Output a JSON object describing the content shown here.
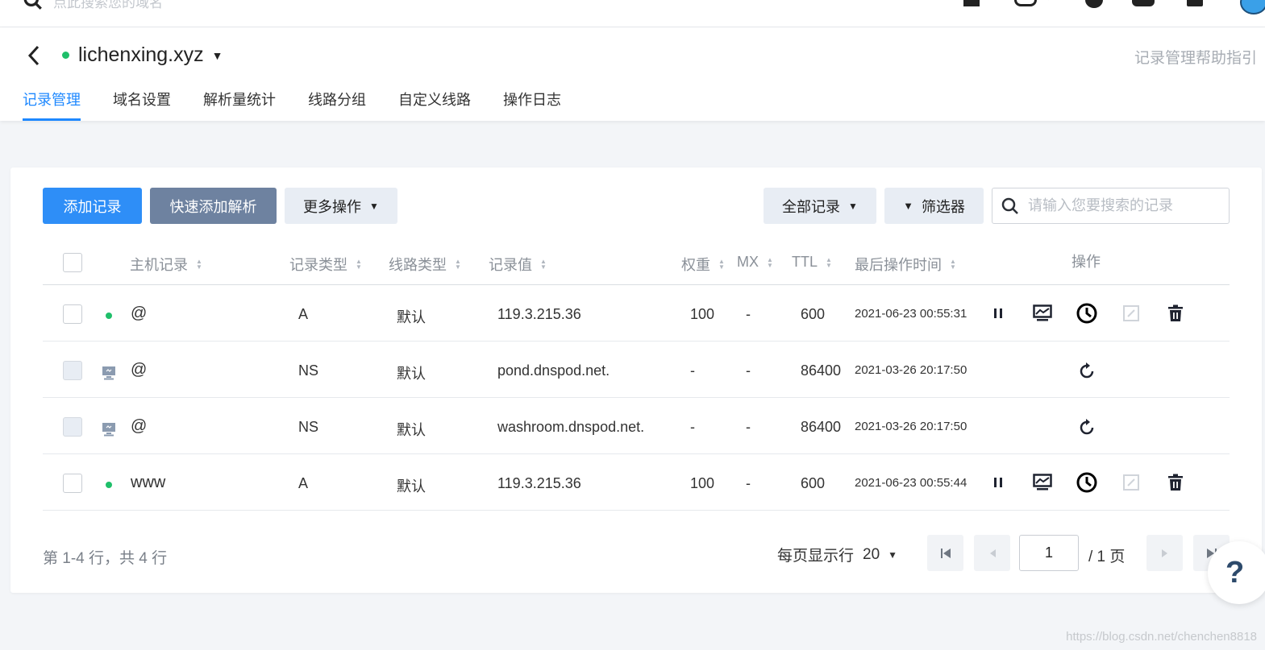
{
  "topbar": {
    "search_placeholder": "点此搜索您的域名"
  },
  "header": {
    "domain": "lichenxing.xyz",
    "help_link": "记录管理帮助指引",
    "tabs": [
      "记录管理",
      "域名设置",
      "解析量统计",
      "线路分组",
      "自定义线路",
      "操作日志"
    ]
  },
  "toolbar": {
    "add_record": "添加记录",
    "quick_add": "快速添加解析",
    "more_ops": "更多操作",
    "all_records": "全部记录",
    "filter": "筛选器",
    "search_placeholder": "请输入您要搜索的记录"
  },
  "table": {
    "columns": [
      "主机记录",
      "记录类型",
      "线路类型",
      "记录值",
      "权重",
      "MX",
      "TTL",
      "最后操作时间",
      "操作"
    ],
    "rows": [
      {
        "status": "enabled",
        "host": "@",
        "type": "A",
        "line": "默认",
        "value": "119.3.215.36",
        "weight": "100",
        "mx": "-",
        "ttl": "600",
        "time": "2021-06-23 00:55:31"
      },
      {
        "status": "system",
        "host": "@",
        "type": "NS",
        "line": "默认",
        "value": "pond.dnspod.net.",
        "weight": "-",
        "mx": "-",
        "ttl": "86400",
        "time": "2021-03-26 20:17:50"
      },
      {
        "status": "system",
        "host": "@",
        "type": "NS",
        "line": "默认",
        "value": "washroom.dnspod.net.",
        "weight": "-",
        "mx": "-",
        "ttl": "86400",
        "time": "2021-03-26 20:17:50"
      },
      {
        "status": "enabled",
        "host": "www",
        "type": "A",
        "line": "默认",
        "value": "119.3.215.36",
        "weight": "100",
        "mx": "-",
        "ttl": "600",
        "time": "2021-06-23 00:55:44"
      }
    ]
  },
  "pager": {
    "total_text": "第 1-4 行，共 4 行",
    "per_page_label": "每页显示行",
    "per_page_value": "20",
    "current_page": "1",
    "total_pages_text": "/ 1 页"
  },
  "help_float": "?",
  "watermark": "https://blog.csdn.net/chenchen8818",
  "colors": {
    "accent": "#1e88ff",
    "primary_btn": "#2e8ef7",
    "secondary_btn": "#6e82a0",
    "status_on": "#1fbf6a"
  }
}
